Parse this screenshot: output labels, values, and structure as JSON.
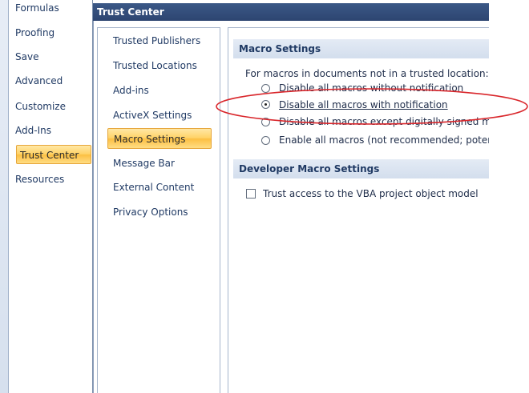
{
  "left_nav": {
    "items": [
      {
        "label": "Formulas"
      },
      {
        "label": "Proofing"
      },
      {
        "label": "Save"
      },
      {
        "label": "Advanced"
      },
      {
        "label": "Customize"
      },
      {
        "label": "Add-Ins"
      },
      {
        "label": "Trust Center",
        "active": true
      },
      {
        "label": "Resources"
      }
    ]
  },
  "dialog": {
    "title": "Trust Center"
  },
  "inner_nav": {
    "items": [
      {
        "label": "Trusted Publishers"
      },
      {
        "label": "Trusted Locations"
      },
      {
        "label": "Add-ins"
      },
      {
        "label": "ActiveX Settings"
      },
      {
        "label": "Macro Settings",
        "active": true
      },
      {
        "label": "Message Bar"
      },
      {
        "label": "External Content"
      },
      {
        "label": "Privacy Options"
      }
    ]
  },
  "macro_settings": {
    "header": "Macro Settings",
    "intro": "For macros in documents not in a trusted location:",
    "options": [
      {
        "label": "Disable all macros without notification",
        "checked": false
      },
      {
        "label": "Disable all macros with notification",
        "checked": true
      },
      {
        "label": "Disable all macros except digitally signed mac",
        "checked": false
      },
      {
        "label": "Enable all macros (not recommended; potenti",
        "checked": false
      }
    ]
  },
  "developer_settings": {
    "header": "Developer Macro Settings",
    "trust_vba_label": "Trust access to the VBA project object model",
    "trust_vba_checked": false
  },
  "annotation": {
    "color": "#d9262b"
  }
}
